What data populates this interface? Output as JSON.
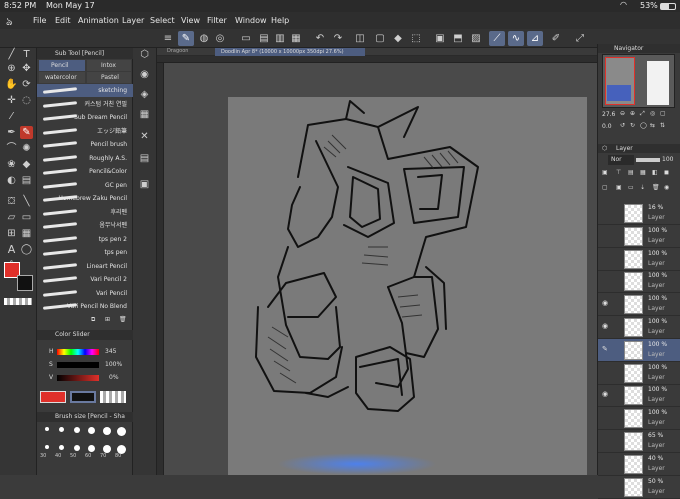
{
  "status": {
    "time": "8:52 PM",
    "date": "Mon May 17",
    "battery": "53%"
  },
  "menu": [
    "File",
    "Edit",
    "Animation",
    "Layer",
    "Select",
    "View",
    "Filter",
    "Window",
    "Help"
  ],
  "tabs": {
    "back": "Dragoon",
    "doc": "Doodlin Apr 8* (10000 x 10000px 350dpi 27.6%)"
  },
  "subtool": {
    "title": "Sub Tool [Pencil]",
    "groups": [
      "Pencil",
      "Intox",
      "watercolor",
      "Pastel"
    ],
    "brushes": [
      "sketching",
      "커스텀 거친 연필",
      "Sub Dream Pencil",
      "エッジ鉛筆",
      "Pencil brush",
      "Roughly A.S.",
      "Pencil&Color",
      "GC pen",
      "Homebrew Zaku Pencil",
      "후리펜",
      "옴무낙서펜",
      "tps pen 2",
      "tps pen",
      "Lineart Pencil",
      "Vari Pencil 2",
      "Vari Pencil",
      "Vari Pencil No Blend"
    ]
  },
  "colorslider": {
    "title": "Color Slider",
    "h_label": "H",
    "h": "345",
    "s_label": "S",
    "s": "100%",
    "v_label": "V",
    "v": "0%"
  },
  "brushsize": {
    "title": "Brush size [Pencil - Sha",
    "sizes": [
      "30",
      "40",
      "50",
      "60",
      "70",
      "80"
    ]
  },
  "navigator": {
    "title": "Navigator",
    "zoom": "27.6",
    "rotation": "0.0"
  },
  "layer": {
    "title": "Layer",
    "blend": "Nor",
    "opacity": "100",
    "rows": [
      {
        "pct": "16 %",
        "name": "Layer"
      },
      {
        "pct": "100 %",
        "name": "Layer"
      },
      {
        "pct": "100 %",
        "name": "Layer"
      },
      {
        "pct": "100 %",
        "name": "Layer"
      },
      {
        "pct": "100 %",
        "name": "Layer"
      },
      {
        "pct": "100 %",
        "name": "Layer"
      },
      {
        "pct": "100 %",
        "name": "Layer"
      },
      {
        "pct": "100 %",
        "name": "Layer"
      },
      {
        "pct": "100 %",
        "name": "Layer"
      },
      {
        "pct": "100 %",
        "name": "Layer"
      },
      {
        "pct": "65 %",
        "name": "Layer"
      },
      {
        "pct": "40 %",
        "name": "Layer"
      },
      {
        "pct": "50 %",
        "name": "Layer"
      }
    ]
  },
  "colors": {
    "main": "#e0302a",
    "sub": "#111111",
    "accent": "#5a6a8a"
  }
}
